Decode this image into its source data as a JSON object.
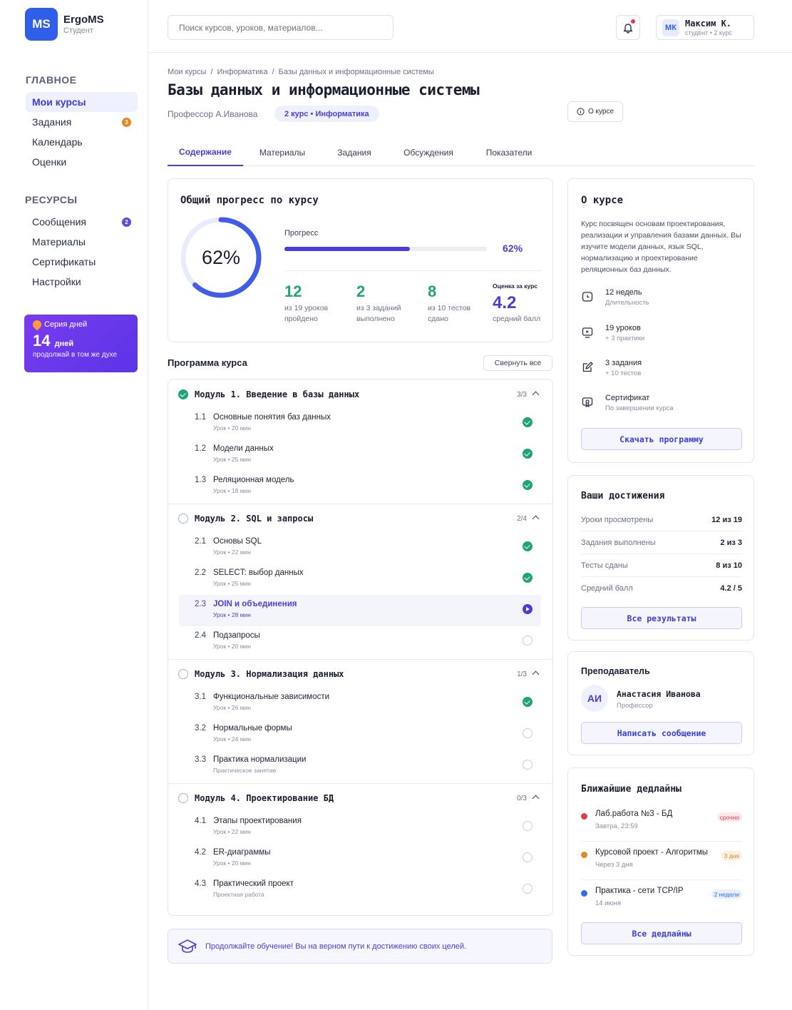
{
  "app": {
    "logo_initials": "MS",
    "name": "ErgoMS",
    "role": "Студент"
  },
  "sidebar": {
    "main_title": "ГЛАВНОЕ",
    "main_items": [
      {
        "label": "Мои курсы"
      },
      {
        "label": "Задания",
        "badge": "3"
      },
      {
        "label": "Календарь"
      },
      {
        "label": "Оценки"
      }
    ],
    "resources_title": "РЕСУРСЫ",
    "resource_items": [
      {
        "label": "Сообщения",
        "badge": "2"
      },
      {
        "label": "Материалы"
      },
      {
        "label": "Сертификаты"
      },
      {
        "label": "Настройки"
      }
    ],
    "streak": {
      "title": "Серия дней",
      "number": "14",
      "unit": "дней",
      "subtitle": "продолжай в том же духе"
    }
  },
  "header": {
    "search_placeholder": "Поиск курсов, уроков, материалов...",
    "user": {
      "initials": "МК",
      "name": "Максим К.",
      "subtitle": "студент • 2 курс"
    }
  },
  "course": {
    "breadcrumbs": [
      "Мои курсы",
      "Информатика",
      "Базы данных и информационные системы"
    ],
    "title": "Базы данных и информационные системы",
    "professor": "Профессор А.Иванова",
    "tag": "2 курс • Информатика",
    "about_button": "О курсе"
  },
  "tabs": [
    "Содержание",
    "Материалы",
    "Задания",
    "Обсуждения",
    "Показатели"
  ],
  "progress": {
    "title": "Общий прогресс по курсу",
    "ring_value": "62%",
    "percent": 62,
    "bar_label": "Прогресс",
    "bar_value": "62%",
    "stats": [
      {
        "value": "12",
        "label1": "из 19 уроков",
        "label2": "пройдено"
      },
      {
        "value": "2",
        "label1": "из 3 заданий",
        "label2": "выполнено"
      },
      {
        "value": "8",
        "label1": "из 10 тестов",
        "label2": "сдано"
      }
    ],
    "grade_title": "Оценка за курс",
    "grade_value": "4.2",
    "grade_label": "средний балл"
  },
  "program": {
    "title": "Программа курса",
    "collapse_label": "Свернуть все",
    "modules": [
      {
        "title": "Модуль 1. Введение в базы данных",
        "count": "3/3",
        "status": "done",
        "lessons": [
          {
            "num": "1.1",
            "title": "Основные понятия баз данных",
            "sub": "Урок • 20 мин",
            "status": "done"
          },
          {
            "num": "1.2",
            "title": "Модели данных",
            "sub": "Урок • 25 мин",
            "status": "done"
          },
          {
            "num": "1.3",
            "title": "Реляционная модель",
            "sub": "Урок • 18 мин",
            "status": "done"
          }
        ]
      },
      {
        "title": "Модуль 2. SQL и запросы",
        "count": "2/4",
        "status": "todo",
        "lessons": [
          {
            "num": "2.1",
            "title": "Основы SQL",
            "sub": "Урок • 22 мин",
            "status": "done"
          },
          {
            "num": "2.2",
            "title": "SELECT: выбор данных",
            "sub": "Урок • 25 мин",
            "status": "done"
          },
          {
            "num": "2.3",
            "title": "JOIN и объединения",
            "sub": "Урок • 28 мин",
            "status": "current"
          },
          {
            "num": "2.4",
            "title": "Подзапросы",
            "sub": "Урок • 20 мин",
            "status": "todo"
          }
        ]
      },
      {
        "title": "Модуль 3. Нормализация данных",
        "count": "1/3",
        "status": "todo",
        "lessons": [
          {
            "num": "3.1",
            "title": "Функциональные зависимости",
            "sub": "Урок • 26 мин",
            "status": "done"
          },
          {
            "num": "3.2",
            "title": "Нормальные формы",
            "sub": "Урок • 24 мин",
            "status": "todo"
          },
          {
            "num": "3.3",
            "title": "Практика нормализации",
            "sub": "Практическое занятие",
            "status": "todo"
          }
        ]
      },
      {
        "title": "Модуль 4. Проектирование БД",
        "count": "0/3",
        "status": "todo",
        "lessons": [
          {
            "num": "4.1",
            "title": "Этапы проектирования",
            "sub": "Урок • 22 мин",
            "status": "todo"
          },
          {
            "num": "4.2",
            "title": "ER-диаграммы",
            "sub": "Урок • 20 мин",
            "status": "todo"
          },
          {
            "num": "4.3",
            "title": "Практический проект",
            "sub": "Проектная работа",
            "status": "todo"
          }
        ]
      }
    ]
  },
  "banner": {
    "text": "Продолжайте обучение! Вы на верном пути к достижению своих целей."
  },
  "about": {
    "title": "О курсе",
    "description": "Курс посвящен основам проектирования, реализации и управления базами данных. Вы изучите модели данных, язык SQL, нормализацию и проектирование реляционных баз данных.",
    "items": [
      {
        "icon": "clock-icon",
        "title": "12 недель",
        "sub": "Длительность"
      },
      {
        "icon": "video-icon",
        "title": "19 уроков",
        "sub": "+ 3 практики"
      },
      {
        "icon": "edit-icon",
        "title": "3 задания",
        "sub": "+ 10 тестов"
      },
      {
        "icon": "certificate-icon",
        "title": "Сертификат",
        "sub": "По завершении курса"
      }
    ],
    "button": "Скачать программу"
  },
  "achievements": {
    "title": "Ваши достижения",
    "rows": [
      {
        "label": "Уроки просмотрены",
        "value": "12 из 19"
      },
      {
        "label": "Задания выполнены",
        "value": "2 из 3"
      },
      {
        "label": "Тесты сданы",
        "value": "8 из 10"
      },
      {
        "label": "Средний балл",
        "value": "4.2 / 5"
      }
    ],
    "button": "Все результаты"
  },
  "teacher": {
    "title": "Преподаватель",
    "initials": "АИ",
    "name": "Анастасия Иванова",
    "role": "Профессор",
    "button": "Написать сообщение"
  },
  "deadlines": {
    "title": "Ближайшие дедлайны",
    "items": [
      {
        "title": "Лаб.работа №3 - БД",
        "sub": "Завтра, 23:59",
        "badge": "срочно",
        "color": "#e53950"
      },
      {
        "title": "Курсовой проект - Алгоритмы",
        "sub": "Через 3 дня",
        "badge": "3 дня",
        "color": "#e58a1f"
      },
      {
        "title": "Практика - сети TCP/IP",
        "sub": "14 июня",
        "badge": "2 недели",
        "color": "#2f6fe8"
      }
    ],
    "button": "Все дедлайны"
  },
  "colors": {
    "accent": "#4b3ed8",
    "success": "#1fa37a",
    "brand": "#2f5fe8"
  }
}
